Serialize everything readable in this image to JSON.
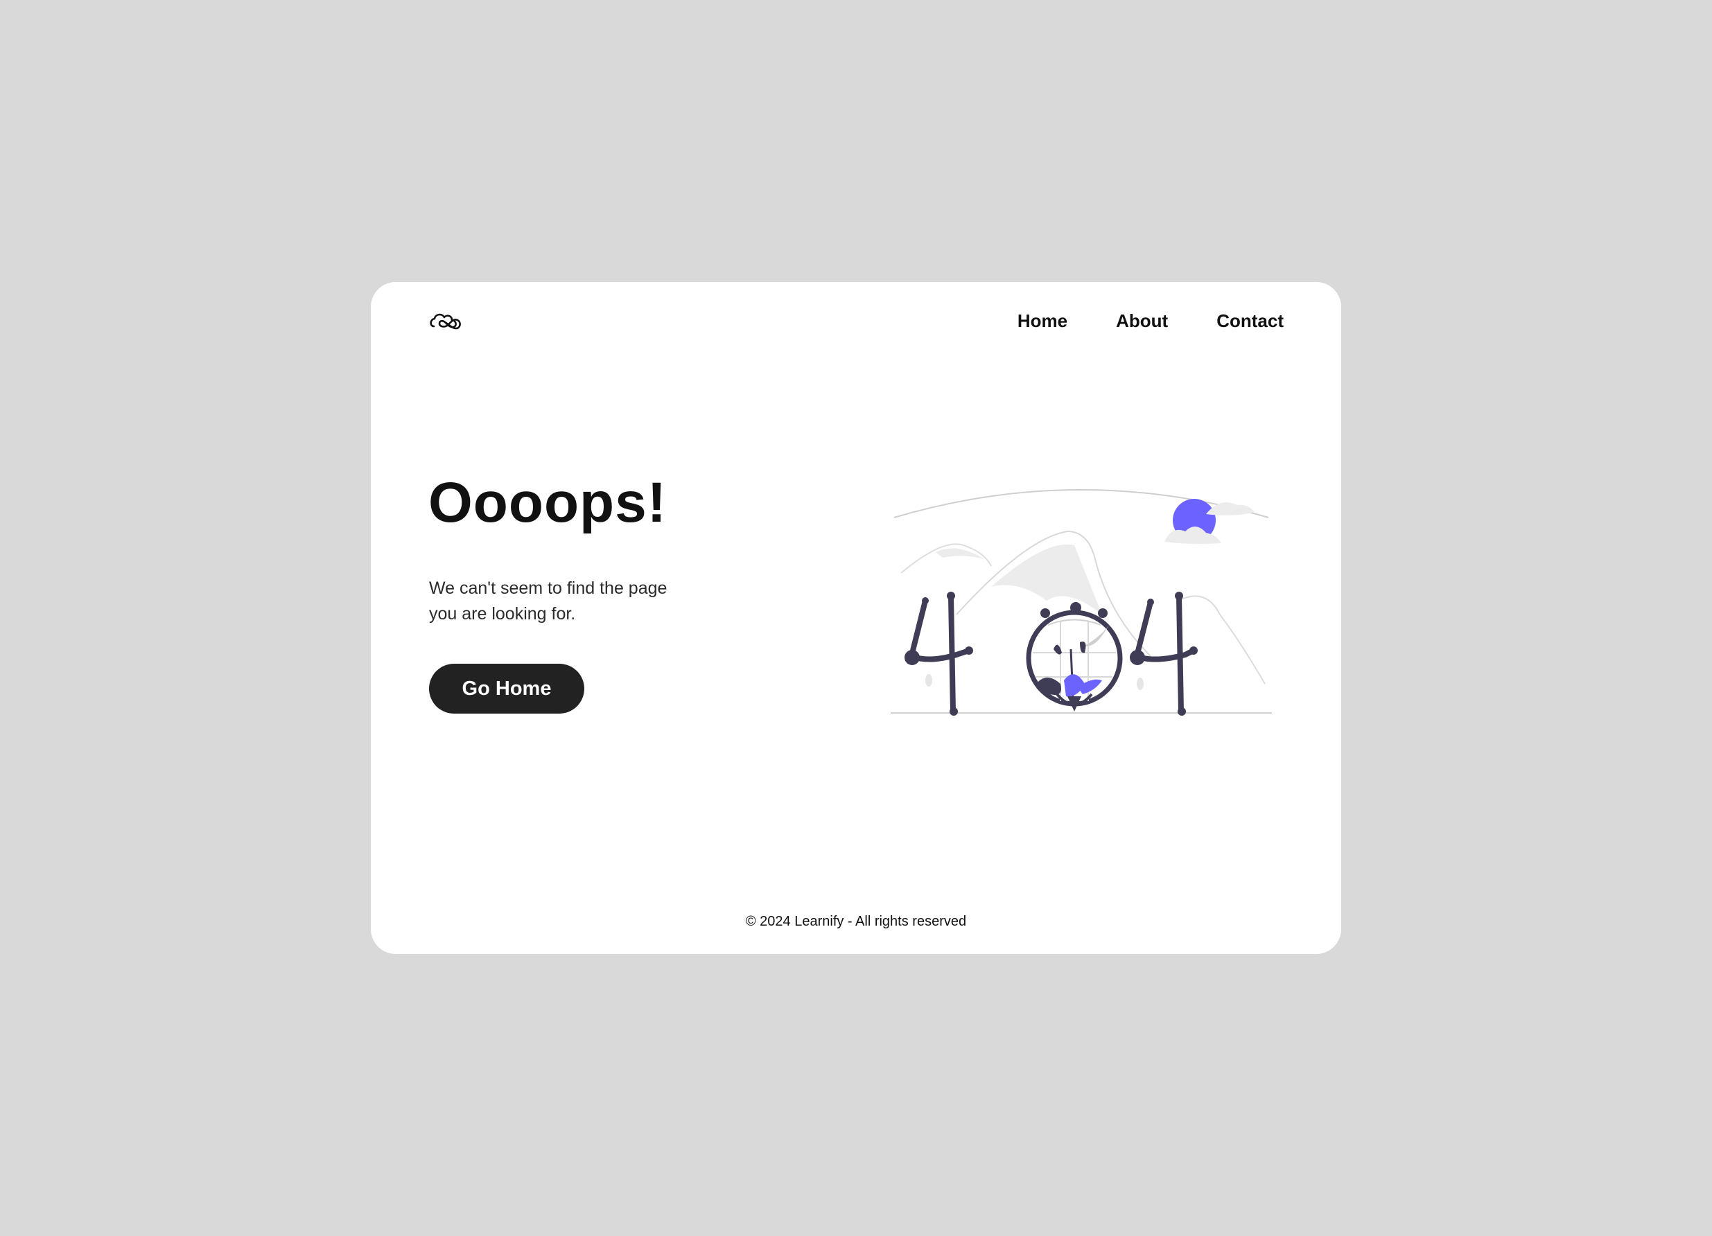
{
  "brand": {
    "logo_icon": "cloud-knot-logo-icon"
  },
  "nav": {
    "items": [
      {
        "label": "Home"
      },
      {
        "label": "About"
      },
      {
        "label": "Contact"
      }
    ]
  },
  "main": {
    "headline": "Oooops!",
    "message_line1": "We can't seem to find the page",
    "message_line2": "you are looking for.",
    "button_label": "Go Home",
    "illustration_icon": "404-illustration"
  },
  "footer": {
    "text": "© 2024 Learnify - All rights reserved"
  },
  "colors": {
    "background": "#d9d9d9",
    "card": "#ffffff",
    "button": "#222222",
    "accent": "#6c63ff",
    "illustration_dark": "#3f3d56"
  }
}
